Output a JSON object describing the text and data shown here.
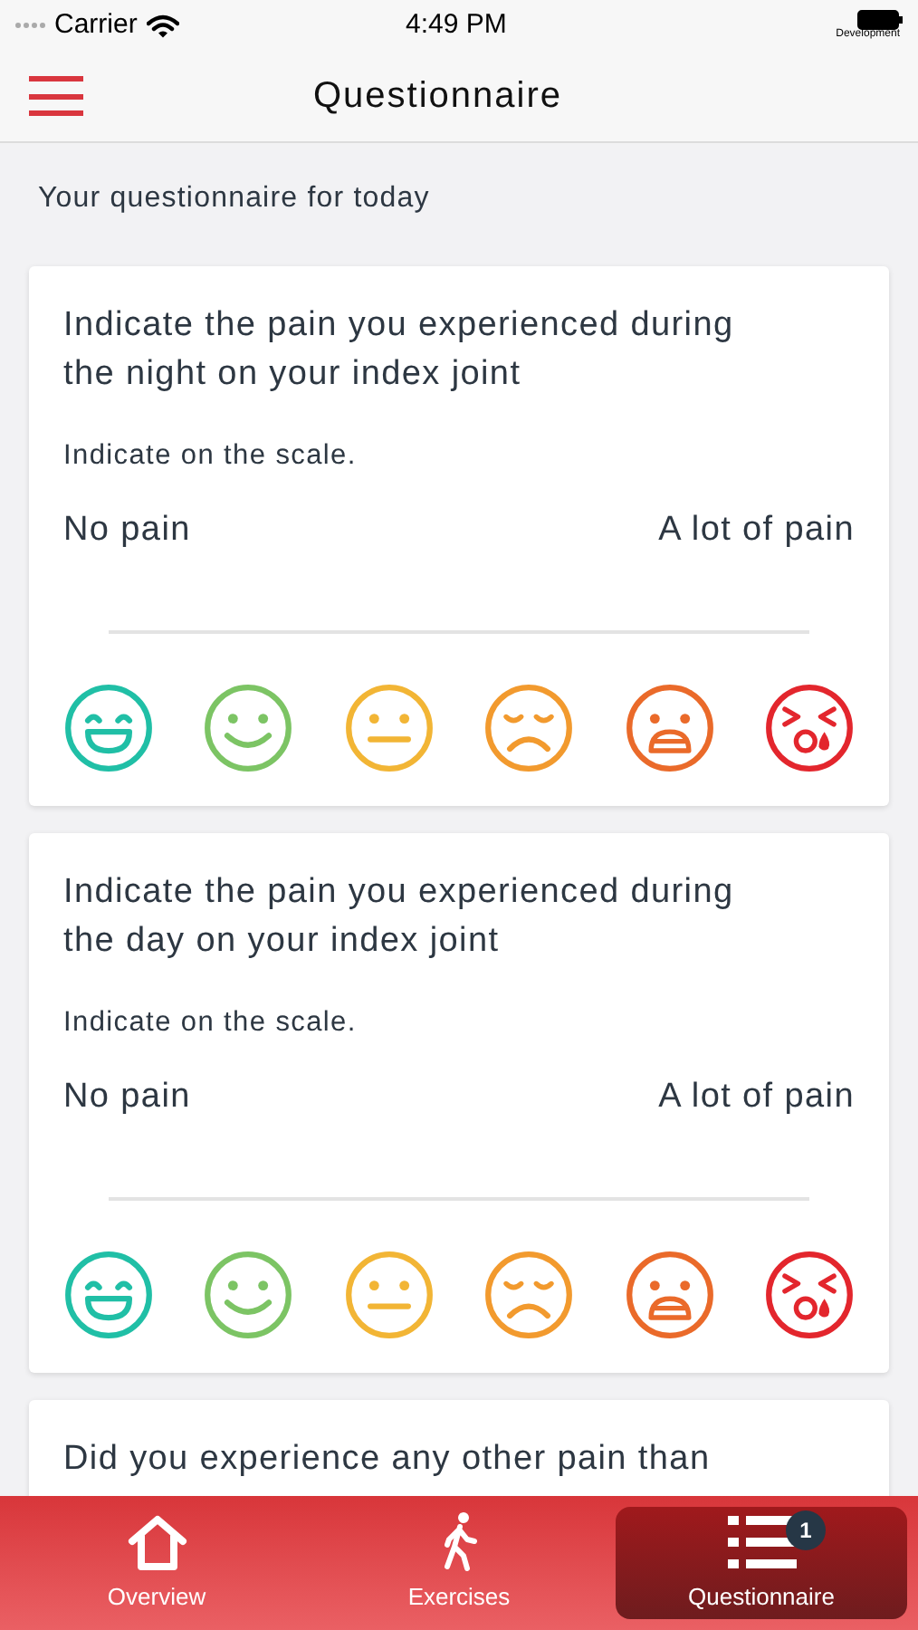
{
  "status_bar": {
    "carrier": "Carrier",
    "time": "4:49 PM",
    "note": "Development"
  },
  "nav": {
    "title": "Questionnaire"
  },
  "intro": "Your questionnaire for today",
  "cards": [
    {
      "question": "Indicate the pain you experienced during the night on your index joint",
      "instruction": "Indicate on the scale.",
      "min_label": "No pain",
      "max_label": "A lot of pain",
      "faces": [
        {
          "kind": "laugh",
          "color": "#20bfa6"
        },
        {
          "kind": "smile",
          "color": "#7cc464"
        },
        {
          "kind": "neutral",
          "color": "#f2b535"
        },
        {
          "kind": "sad",
          "color": "#f29a2e"
        },
        {
          "kind": "upset",
          "color": "#ea6a2a"
        },
        {
          "kind": "cry",
          "color": "#e3262d"
        }
      ]
    },
    {
      "question": "Indicate the pain you experienced during the day on your index joint",
      "instruction": "Indicate on the scale.",
      "min_label": "No pain",
      "max_label": "A lot of pain",
      "faces": [
        {
          "kind": "laugh",
          "color": "#20bfa6"
        },
        {
          "kind": "smile",
          "color": "#7cc464"
        },
        {
          "kind": "neutral",
          "color": "#f2b535"
        },
        {
          "kind": "sad",
          "color": "#f29a2e"
        },
        {
          "kind": "upset",
          "color": "#ea6a2a"
        },
        {
          "kind": "cry",
          "color": "#e3262d"
        }
      ]
    },
    {
      "question": "Did you experience any other pain than"
    }
  ],
  "tabs": [
    {
      "label": "Overview",
      "kind": "home",
      "selected": false
    },
    {
      "label": "Exercises",
      "kind": "walk",
      "selected": false
    },
    {
      "label": "Questionnaire",
      "kind": "list",
      "selected": true,
      "badge": "1"
    }
  ]
}
